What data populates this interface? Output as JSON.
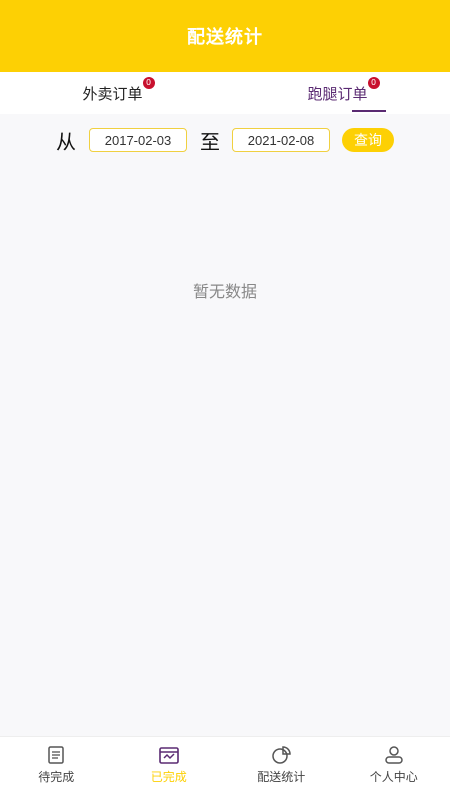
{
  "header": {
    "title": "配送统计"
  },
  "tabs": [
    {
      "label": "外卖订单",
      "badge": "0",
      "active": false
    },
    {
      "label": "跑腿订单",
      "badge": "0",
      "active": true
    }
  ],
  "filter": {
    "from_label": "从",
    "from_date": "2017-02-03",
    "to_label": "至",
    "to_date": "2021-02-08",
    "query_label": "查询"
  },
  "empty": {
    "text": "暂无数据"
  },
  "bottom_nav": [
    {
      "label": "待完成",
      "icon": "document-icon",
      "active": false
    },
    {
      "label": "已完成",
      "icon": "completed-icon",
      "active": true
    },
    {
      "label": "配送统计",
      "icon": "pie-chart-icon",
      "active": false
    },
    {
      "label": "个人中心",
      "icon": "person-icon",
      "active": false
    }
  ],
  "colors": {
    "accent": "#fdd004",
    "tab_active": "#5a2a72",
    "badge": "#c8102e"
  }
}
